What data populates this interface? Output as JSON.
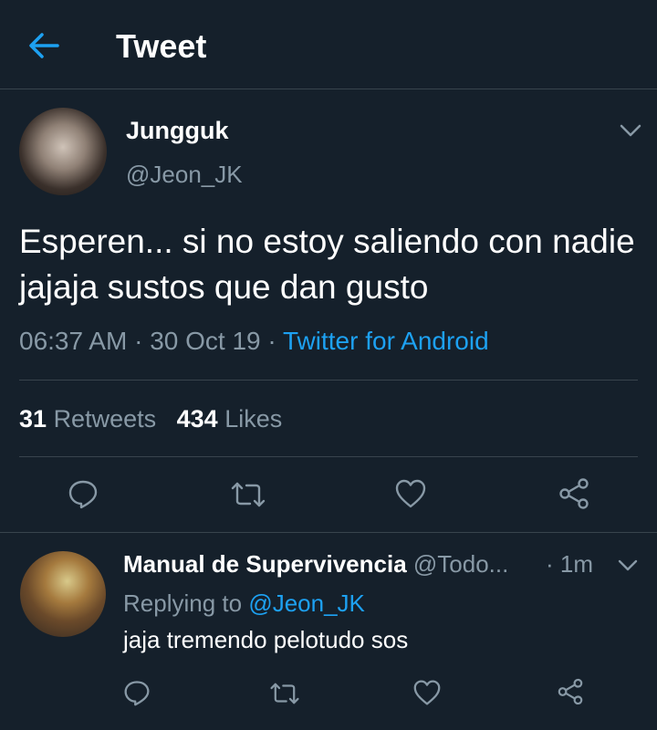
{
  "header": {
    "title": "Tweet",
    "back_icon": "arrow-left-icon"
  },
  "tweet": {
    "author_name": "Jungguk",
    "author_handle": "@Jeon_JK",
    "text": "Esperen... si no estoy saliendo con nadie jajaja sustos que dan gusto",
    "time": "06:37 AM",
    "date": "30 Oct 19",
    "separator": " · ",
    "source": "Twitter for Android",
    "retweets_count": "31",
    "retweets_label": "Retweets",
    "likes_count": "434",
    "likes_label": "Likes"
  },
  "reply": {
    "author_name": "Manual de Supervivencia",
    "author_handle": "@Todo...",
    "time": "· 1m",
    "replying_prefix": "Replying to",
    "replying_to": "@Jeon_JK",
    "text": "jaja tremendo pelotudo sos"
  },
  "colors": {
    "background": "#15202b",
    "accent": "#1da1f2",
    "muted": "#8899a6",
    "divider": "#38444d"
  }
}
